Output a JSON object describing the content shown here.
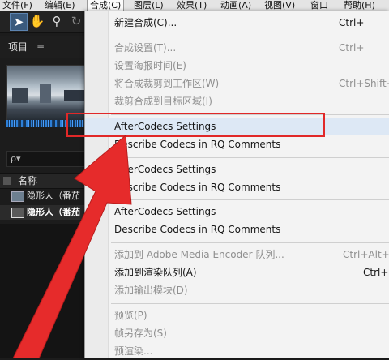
{
  "menubar": {
    "items": [
      "文件(F)",
      "编辑(E)",
      "合成(C)",
      "图层(L)",
      "效果(T)",
      "动画(A)",
      "视图(V)",
      "窗口",
      "帮助(H)"
    ],
    "active_index": 2
  },
  "left_panel": {
    "title": "项目",
    "menu_glyph": "≡",
    "search_glyph": "ρ▾",
    "column_header": "名称",
    "rows": [
      "隐形人（番茄",
      "隐形人（番茄"
    ]
  },
  "menu": {
    "items": [
      {
        "label": "新建合成(C)...",
        "shortcut": "Ctrl+",
        "enabled": true
      },
      {
        "label": "合成设置(T)...",
        "shortcut": "Ctrl+",
        "enabled": false
      },
      {
        "label": "设置海报时间(E)",
        "shortcut": "",
        "enabled": false
      },
      {
        "label": "将合成裁剪到工作区(W)",
        "shortcut": "Ctrl+Shift+",
        "enabled": false
      },
      {
        "label": "裁剪合成到目标区域(I)",
        "shortcut": "",
        "enabled": false
      },
      {
        "label": "AfterCodecs Settings",
        "shortcut": "",
        "enabled": true
      },
      {
        "label": "Describe Codecs in RQ Comments",
        "shortcut": "",
        "enabled": true
      },
      {
        "label": "AfterCodecs Settings",
        "shortcut": "",
        "enabled": true
      },
      {
        "label": "Describe Codecs in RQ Comments",
        "shortcut": "",
        "enabled": true
      },
      {
        "label": "AfterCodecs Settings",
        "shortcut": "",
        "enabled": true
      },
      {
        "label": "Describe Codecs in RQ Comments",
        "shortcut": "",
        "enabled": true
      },
      {
        "label": "添加到 Adobe Media Encoder 队列...",
        "shortcut": "Ctrl+Alt+M",
        "enabled": false
      },
      {
        "label": "添加到渲染队列(A)",
        "shortcut": "Ctrl+M",
        "enabled": true
      },
      {
        "label": "添加输出模块(D)",
        "shortcut": "",
        "enabled": false
      },
      {
        "label": "预览(P)",
        "shortcut": "",
        "enabled": false
      },
      {
        "label": "帧另存为(S)",
        "shortcut": "",
        "enabled": false
      },
      {
        "label": "预渲染...",
        "shortcut": "",
        "enabled": false
      }
    ]
  },
  "colors": {
    "highlight_box": "#e12828",
    "arrow": "#e62b2b",
    "menu_bg": "#f3f3f3",
    "app_bg": "#1c1c1c"
  }
}
